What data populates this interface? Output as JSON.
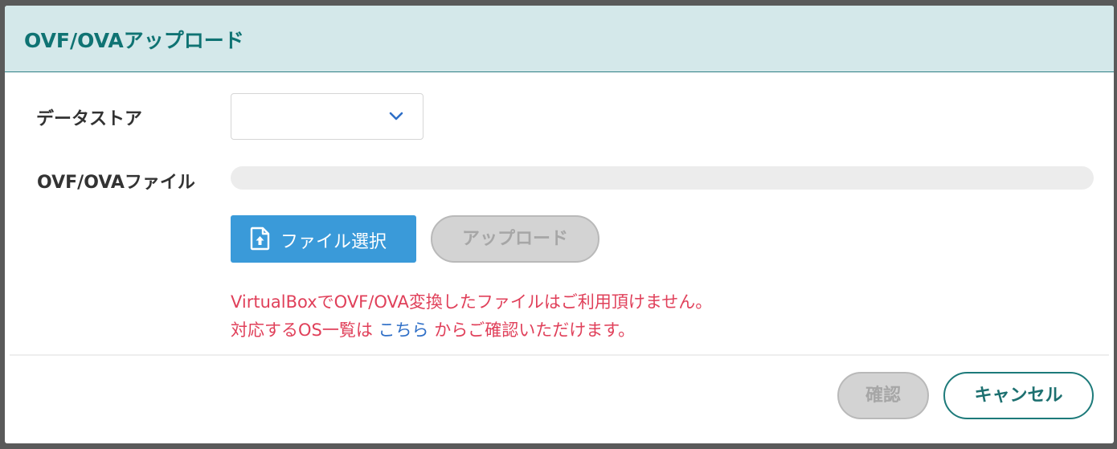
{
  "dialog": {
    "title": "OVF/OVAアップロード"
  },
  "form": {
    "datastore_label": "データストア",
    "datastore_value": "",
    "file_label": "OVF/OVAファイル",
    "file_value": ""
  },
  "buttons": {
    "select_file": "ファイル選択",
    "upload": "アップロード",
    "confirm": "確認",
    "cancel": "キャンセル"
  },
  "notice": {
    "line1": "VirtualBoxでOVF/OVA変換したファイルはご利用頂けません。",
    "line2_prefix": "対応するOS一覧は ",
    "line2_link": "こちら",
    "line2_suffix": " からご確認いただけます。"
  },
  "icons": {
    "select_chevron": "chevron-down-icon",
    "file_upload": "file-upload-icon"
  },
  "colors": {
    "header_bg": "#d4e8ea",
    "title": "#0f7373",
    "primary_button": "#3a9ad9",
    "disabled_button": "#d3d3d3",
    "notice_text": "#e0405a",
    "link": "#2f6fc7",
    "cancel_border": "#1d7a7a"
  }
}
